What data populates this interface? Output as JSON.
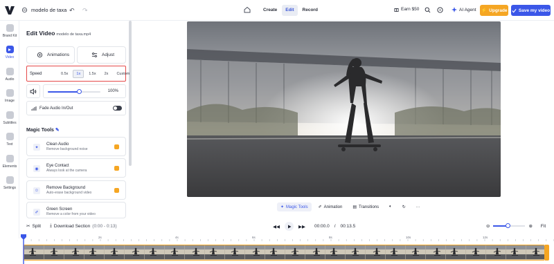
{
  "header": {
    "project_name": "modelo de taxa",
    "tabs": [
      {
        "label": "Create",
        "active": false
      },
      {
        "label": "Edit",
        "active": true
      },
      {
        "label": "Record",
        "active": false
      }
    ],
    "earn_label": "Earn $50",
    "agent_label": "AI Agent",
    "upgrade_label": "Upgrade",
    "save_label": "Save my video"
  },
  "rail": {
    "items": [
      {
        "label": "Brand Kit",
        "active": false
      },
      {
        "label": "Video",
        "active": true
      },
      {
        "label": "Audio",
        "active": false
      },
      {
        "label": "Image",
        "active": false
      },
      {
        "label": "Subtitles",
        "active": false
      },
      {
        "label": "Text",
        "active": false
      },
      {
        "label": "Elements",
        "active": false
      },
      {
        "label": "Settings",
        "active": false
      }
    ]
  },
  "panel": {
    "title": "Edit Video",
    "file_name": "modelo de taxa.mp4",
    "tabs": {
      "animations": "Animations",
      "adjust": "Adjust"
    },
    "speed": {
      "label": "Speed",
      "options": [
        "0.5x",
        "1x",
        "1.5x",
        "2x",
        "Custom"
      ],
      "selected": "1x"
    },
    "volume": {
      "value_label": "100%",
      "level": 0.6
    },
    "fade": {
      "label": "Fade Audio In/Out",
      "enabled": true
    },
    "magic_tools_title": "Magic Tools",
    "tools": [
      {
        "name": "Clean Audio",
        "desc": "Remove background noise"
      },
      {
        "name": "Eye Contact",
        "desc": "Always look at the camera"
      },
      {
        "name": "Remove Background",
        "desc": "Auto-erase background video"
      },
      {
        "name": "Green Screen",
        "desc": "Remove a color from your video"
      }
    ]
  },
  "preview_toolbar": {
    "magic_tools": "Magic Tools",
    "animation": "Animation",
    "transitions": "Transitions"
  },
  "timeline": {
    "split_label": "Split",
    "download_label": "Download Section",
    "section_range": "(0:00 - 0:13)",
    "current_time": "00:00.0",
    "separator": "/",
    "total_time": "00:13.5",
    "fit_label": "Fit",
    "zoom_level": 0.45,
    "ruler_labels": [
      "2s",
      "4s",
      "6s",
      "8s",
      "10s",
      "12s"
    ]
  },
  "colors": {
    "accent": "#3b57e8",
    "upgrade": "#f5a623",
    "highlight_border": "#e54848"
  }
}
